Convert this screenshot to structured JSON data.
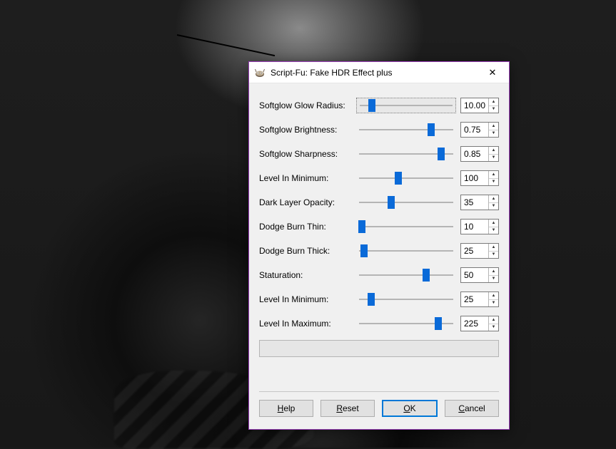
{
  "window": {
    "title": "Script-Fu: Fake HDR Effect plus",
    "close_glyph": "✕"
  },
  "params": [
    {
      "key": "softglow_glow_radius",
      "label": "Softglow Glow Radius:",
      "value": "10.00",
      "pos": 15,
      "focused": true
    },
    {
      "key": "softglow_brightness",
      "label": "Softglow Brightness:",
      "value": "0.75",
      "pos": 75
    },
    {
      "key": "softglow_sharpness",
      "label": "Softglow Sharpness:",
      "value": "0.85",
      "pos": 85
    },
    {
      "key": "level_in_minimum_1",
      "label": "Level In Minimum:",
      "value": "100",
      "pos": 42
    },
    {
      "key": "dark_layer_opacity",
      "label": "Dark Layer Opacity:",
      "value": "35",
      "pos": 35
    },
    {
      "key": "dodge_burn_thin",
      "label": "Dodge Burn Thin:",
      "value": "10",
      "pos": 6
    },
    {
      "key": "dodge_burn_thick",
      "label": "Dodge Burn Thick:",
      "value": "25",
      "pos": 8
    },
    {
      "key": "staturation",
      "label": "Staturation:",
      "value": "50",
      "pos": 70
    },
    {
      "key": "level_in_minimum_2",
      "label": "Level In Minimum:",
      "value": "25",
      "pos": 15
    },
    {
      "key": "level_in_maximum",
      "label": "Level In Maximum:",
      "value": "225",
      "pos": 82
    }
  ],
  "buttons": {
    "help": {
      "text": "Help",
      "mnemonic_index": 0
    },
    "reset": {
      "text": "Reset",
      "mnemonic_index": 0
    },
    "ok": {
      "text": "OK",
      "mnemonic_index": 0
    },
    "cancel": {
      "text": "Cancel",
      "mnemonic_index": 0
    }
  }
}
